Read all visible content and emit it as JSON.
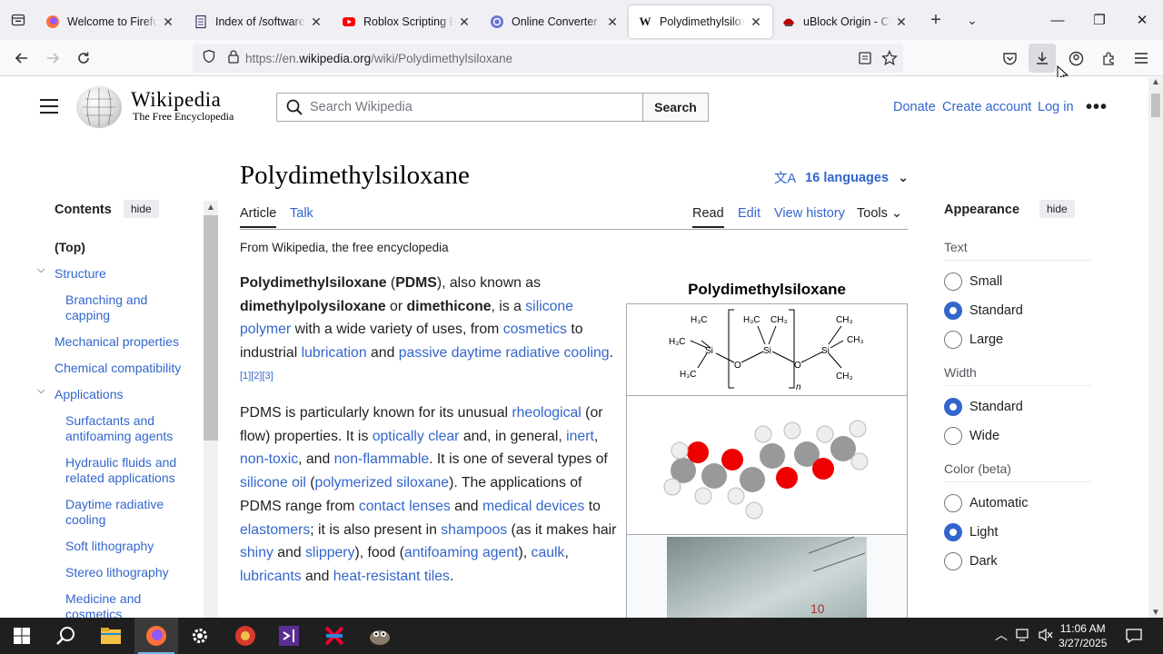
{
  "browser": {
    "tabs": [
      {
        "label": "Welcome to Firefox",
        "icon": "firefox-icon"
      },
      {
        "label": "Index of /software/v",
        "icon": "document-icon"
      },
      {
        "label": "Roblox Scripting Be",
        "icon": "youtube-icon"
      },
      {
        "label": "Online Converter - ",
        "icon": "converter-icon"
      },
      {
        "label": "Polydimethylsiloxan",
        "icon": "wikipedia-icon"
      },
      {
        "label": "uBlock Origin - Chr",
        "icon": "ublock-icon"
      }
    ],
    "active_tab_index": 4,
    "url_prefix": "https://en.",
    "url_domain": "wikipedia.org",
    "url_path": "/wiki/Polydimethylsiloxane"
  },
  "header": {
    "wordmark": "Wikipedia",
    "tagline": "The Free Encyclopedia",
    "search_placeholder": "Search Wikipedia",
    "search_button": "Search",
    "donate": "Donate",
    "create_account": "Create account",
    "log_in": "Log in"
  },
  "toc": {
    "title": "Contents",
    "hide": "hide",
    "items": [
      {
        "label": "(Top)"
      },
      {
        "label": "Structure"
      },
      {
        "label": "Branching and capping"
      },
      {
        "label": "Mechanical properties"
      },
      {
        "label": "Chemical compatibility"
      },
      {
        "label": "Applications"
      },
      {
        "label": "Surfactants and antifoaming agents"
      },
      {
        "label": "Hydraulic fluids and related applications"
      },
      {
        "label": "Daytime radiative cooling"
      },
      {
        "label": "Soft lithography"
      },
      {
        "label": "Stereo lithography"
      },
      {
        "label": "Medicine and cosmetics"
      }
    ]
  },
  "article": {
    "title": "Polydimethylsiloxane",
    "languages": "16 languages",
    "tab_article": "Article",
    "tab_talk": "Talk",
    "tab_read": "Read",
    "tab_edit": "Edit",
    "tab_history": "View history",
    "tab_tools": "Tools",
    "from": "From Wikipedia, the free encyclopedia",
    "p1": {
      "b1": "Polydimethylsiloxane",
      "t1": " (",
      "b2": "PDMS",
      "t2": "), also known as ",
      "b3": "dimethylpolysiloxane",
      "t3": " or ",
      "b4": "dimethicone",
      "t4": ", is a ",
      "l1": "silicone polymer",
      "t5": " with a wide variety of uses, from ",
      "l2": "cosmetics",
      "t6": " to industrial ",
      "l3": "lubrication",
      "t7": " and ",
      "l4": "passive daytime radiative cooling",
      "t8": ".",
      "refs": "[1][2][3]"
    },
    "p2": {
      "t1": "PDMS is particularly known for its unusual ",
      "l1": "rheological",
      "t2": " (or flow) properties. It is ",
      "l2": "optically clear",
      "t3": " and, in general, ",
      "l3": "inert",
      "t4": ", ",
      "l4": "non-toxic",
      "t5": ", and ",
      "l5": "non-flammable",
      "t6": ". It is one of several types of ",
      "l6": "silicone oil",
      "t7": " (",
      "l7": "polymerized siloxane",
      "t8": "). The applications of PDMS range from ",
      "l8": "contact lenses",
      "t9": " and ",
      "l9": "medical devices",
      "t10": " to ",
      "l10": "elastomers",
      "t11": "; it is also present in ",
      "l11": "shampoos",
      "t12": " (as it makes hair ",
      "l12": "shiny",
      "t13": " and ",
      "l13": "slippery",
      "t14": "), food (",
      "l14": "antifoaming agent",
      "t15": "), ",
      "l15": "caulk",
      "t16": ", ",
      "l16": "lubricants",
      "t17": " and ",
      "l17": "heat-resistant tiles",
      "t18": "."
    },
    "infobox_title": "Polydimethylsiloxane",
    "structure_labels": {
      "h3c": "H₃C",
      "ch3": "CH₃",
      "si": "Si",
      "o": "O",
      "n": "n"
    },
    "vial_text": "10"
  },
  "appearance": {
    "title": "Appearance",
    "hide": "hide",
    "text_heading": "Text",
    "text_options": [
      "Small",
      "Standard",
      "Large"
    ],
    "text_selected": "Standard",
    "width_heading": "Width",
    "width_options": [
      "Standard",
      "Wide"
    ],
    "width_selected": "Standard",
    "color_heading": "Color (beta)",
    "color_options": [
      "Automatic",
      "Light",
      "Dark"
    ],
    "color_selected": "Light"
  },
  "taskbar": {
    "time": "11:06 AM",
    "date": "3/27/2025"
  },
  "colors": {
    "link": "#3366cc",
    "text": "#202122",
    "taskbar": "#1f1f1f"
  }
}
